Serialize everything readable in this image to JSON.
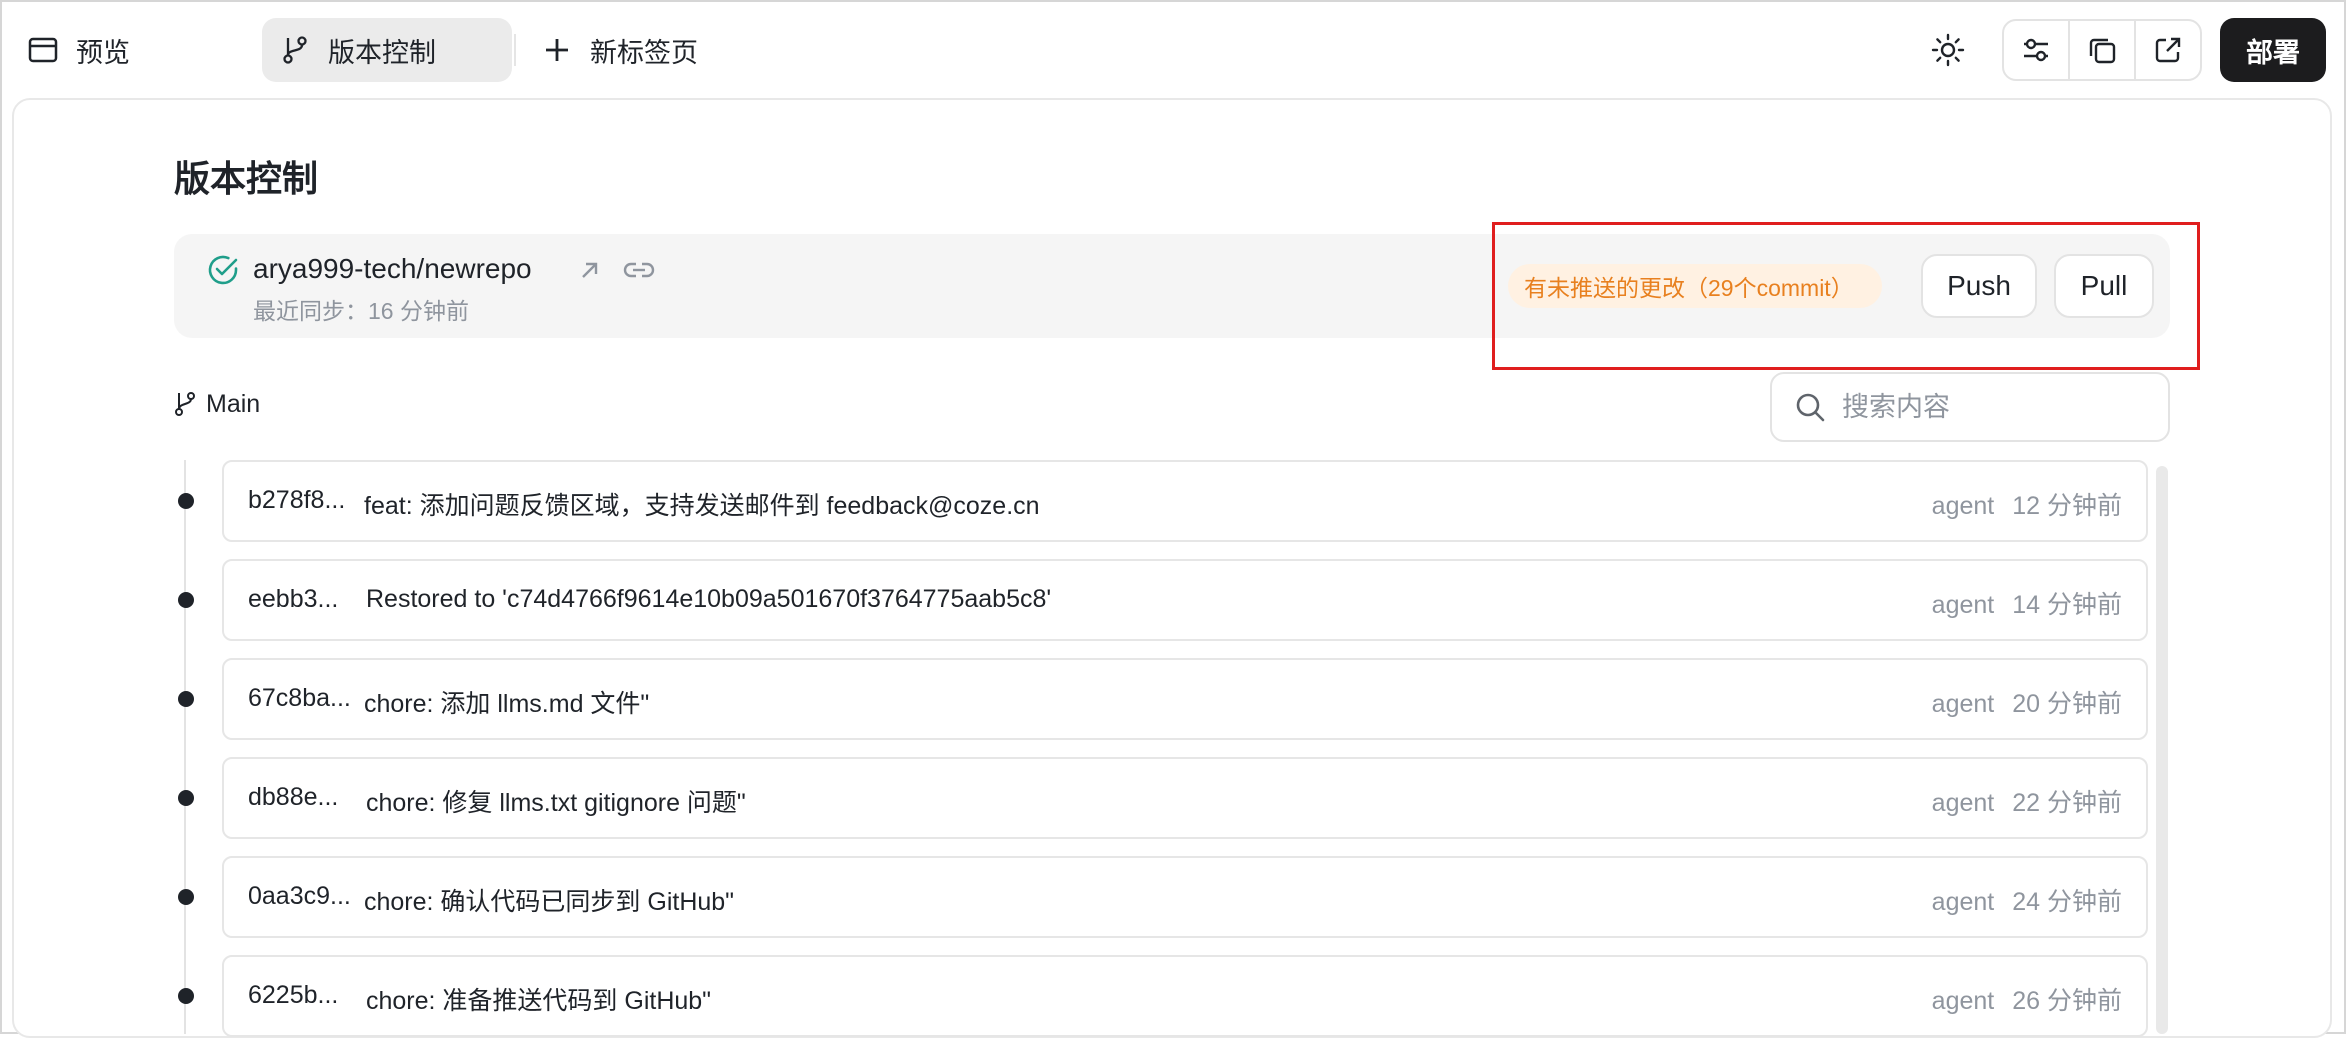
{
  "topbar": {
    "tabs": [
      {
        "label": "预览",
        "icon": "window-icon"
      },
      {
        "label": "版本控制",
        "icon": "branch-icon"
      },
      {
        "label": "新标签页",
        "icon": "plus-icon"
      }
    ],
    "deploy_label": "部署"
  },
  "page": {
    "title": "版本控制"
  },
  "repo": {
    "name": "arya999-tech/newrepo",
    "last_sync": "最近同步：16 分钟前",
    "status_badge": "有未推送的更改（29个commit）",
    "push_label": "Push",
    "pull_label": "Pull"
  },
  "branch": {
    "name": "Main"
  },
  "search": {
    "placeholder": "搜索内容"
  },
  "commits": [
    {
      "hash": "b278f8...",
      "message": "feat: 添加问题反馈区域，支持发送邮件到 feedback@coze.cn",
      "author": "agent",
      "time": "12 分钟前"
    },
    {
      "hash": "eebb3...",
      "message": "Restored to 'c74d4766f9614e10b09a501670f3764775aab5c8'",
      "author": "agent",
      "time": "14 分钟前"
    },
    {
      "hash": "67c8ba...",
      "message": "chore: 添加 llms.md 文件\"",
      "author": "agent",
      "time": "20 分钟前"
    },
    {
      "hash": "db88e...",
      "message": "chore: 修复 llms.txt gitignore 问题\"",
      "author": "agent",
      "time": "22 分钟前"
    },
    {
      "hash": "0aa3c9...",
      "message": "chore: 确认代码已同步到 GitHub\"",
      "author": "agent",
      "time": "24 分钟前"
    },
    {
      "hash": "6225b...",
      "message": "chore: 准备推送代码到 GitHub\"",
      "author": "agent",
      "time": "26 分钟前"
    }
  ],
  "colors": {
    "accent_green": "#1f9e8a",
    "badge_text": "#e8801f",
    "badge_bg": "#fff1e2",
    "highlight_red": "#e01e1e",
    "deploy_bg": "#1c1c1e"
  }
}
